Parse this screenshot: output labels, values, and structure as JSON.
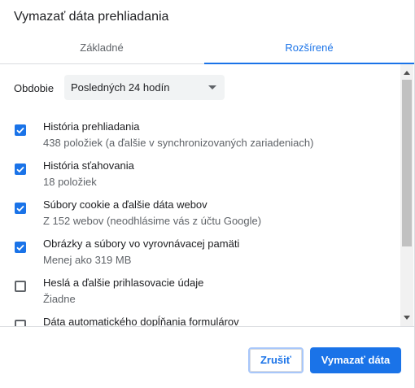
{
  "dialog": {
    "title": "Vymazať dáta prehliadania"
  },
  "tabs": {
    "basic": "Základné",
    "advanced": "Rozšírené"
  },
  "period": {
    "label": "Obdobie",
    "selected": "Posledných 24 hodín"
  },
  "items": [
    {
      "label": "História prehliadania",
      "sub": "438 položiek (a ďalšie v synchronizovaných zariadeniach)",
      "checked": true
    },
    {
      "label": "História sťahovania",
      "sub": "18 položiek",
      "checked": true
    },
    {
      "label": "Súbory cookie a ďalšie dáta webov",
      "sub": "Z 152 webov (neodhlásime vás z účtu Google)",
      "checked": true
    },
    {
      "label": "Obrázky a súbory vo vyrovnávacej pamäti",
      "sub": "Menej ako 319 MB",
      "checked": true
    },
    {
      "label": "Heslá a ďalšie prihlasovacie údaje",
      "sub": "Žiadne",
      "checked": false
    },
    {
      "label": "Dáta automatického dopĺňania formulárov",
      "sub": "",
      "checked": false
    }
  ],
  "buttons": {
    "cancel": "Zrušiť",
    "clear": "Vymazať dáta"
  },
  "colors": {
    "accent": "#1a73e8",
    "text": "#202124",
    "secondary_text": "#5f6368"
  }
}
